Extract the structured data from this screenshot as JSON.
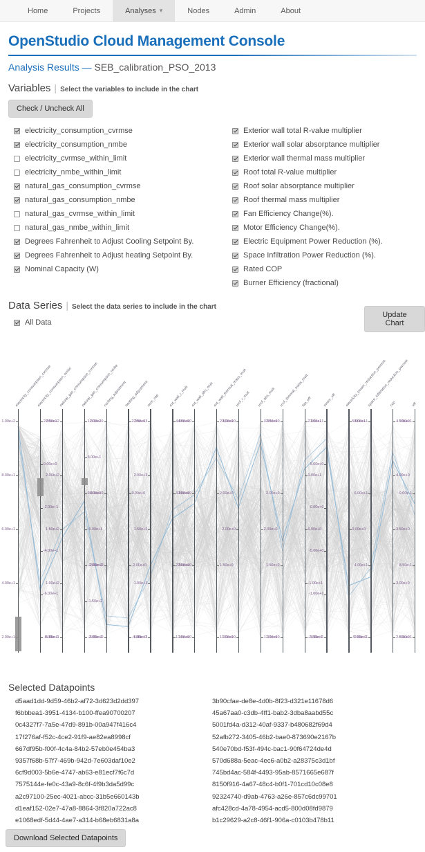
{
  "navbar": {
    "items": [
      {
        "label": "Home",
        "active": false,
        "caret": false
      },
      {
        "label": "Projects",
        "active": false,
        "caret": false
      },
      {
        "label": "Analyses",
        "active": true,
        "caret": true
      },
      {
        "label": "Nodes",
        "active": false,
        "caret": false
      },
      {
        "label": "Admin",
        "active": false,
        "caret": false
      },
      {
        "label": "About",
        "active": false,
        "caret": false
      }
    ],
    "caret_glyph": "▾"
  },
  "header": {
    "app_title": "OpenStudio Cloud Management Console",
    "page_label": "Analysis Results",
    "dash": "—",
    "analysis_name": "SEB_calibration_PSO_2013",
    "accent_color": "#1a6fbb"
  },
  "variables": {
    "heading": "Variables",
    "separator": "|",
    "hint": "Select the variables to include in the chart",
    "check_all_label": "Check / Uncheck All",
    "left_column": [
      {
        "label": "electricity_consumption_cvrmse",
        "checked": true
      },
      {
        "label": "electricity_consumption_nmbe",
        "checked": true
      },
      {
        "label": "electricity_cvrmse_within_limit",
        "checked": false
      },
      {
        "label": "electricity_nmbe_within_limit",
        "checked": false
      },
      {
        "label": "natural_gas_consumption_cvrmse",
        "checked": true
      },
      {
        "label": "natural_gas_consumption_nmbe",
        "checked": true
      },
      {
        "label": "natural_gas_cvrmse_within_limit",
        "checked": false
      },
      {
        "label": "natural_gas_nmbe_within_limit",
        "checked": false
      },
      {
        "label": "Degrees Fahrenheit to Adjust Cooling Setpoint By.",
        "checked": true
      },
      {
        "label": "Degrees Fahrenheit to Adjust heating Setpoint By.",
        "checked": true
      },
      {
        "label": "Nominal Capacity (W)",
        "checked": true
      }
    ],
    "right_column": [
      {
        "label": "Exterior wall total R-value multiplier",
        "checked": true
      },
      {
        "label": "Exterior wall solar absorptance multiplier",
        "checked": true
      },
      {
        "label": "Exterior wall thermal mass multiplier",
        "checked": true
      },
      {
        "label": "Roof total R-value multiplier",
        "checked": true
      },
      {
        "label": "Roof solar absorptance multiplier",
        "checked": true
      },
      {
        "label": "Roof thermal mass multiplier",
        "checked": true
      },
      {
        "label": "Fan Efficiency Change(%).",
        "checked": true
      },
      {
        "label": "Motor Efficiency Change(%).",
        "checked": true
      },
      {
        "label": "Electric Equipment Power Reduction (%).",
        "checked": true
      },
      {
        "label": "Space Infiltration Power Reduction (%).",
        "checked": true
      },
      {
        "label": "Rated COP",
        "checked": true
      },
      {
        "label": "Burner Efficiency (fractional)",
        "checked": true
      }
    ]
  },
  "data_series": {
    "heading": "Data Series",
    "separator": "|",
    "hint": "Select the data series to include in the chart",
    "items": [
      {
        "label": "All Data",
        "checked": true
      }
    ]
  },
  "toolbar": {
    "update_chart_label": "Update Chart",
    "download_label": "Download Selected Datapoints"
  },
  "chart_data": {
    "type": "line",
    "subtype": "parallel-coordinates",
    "title": "",
    "xlabel": "",
    "ylabel": "",
    "grid": false,
    "legend": "none",
    "highlight_color": "#8fb8d6",
    "line_color": "#d9d9d9",
    "axes": [
      {
        "name": "electricity_consumption_cvrmse",
        "ticks": [
          "1.00e+2",
          "8.00e+1",
          "6.00e+1",
          "4.00e+1",
          "2.00e+1"
        ],
        "brush": true
      },
      {
        "name": "electricity_consumption_nmbe",
        "ticks": [
          "2.00e+1",
          "0.00e+0",
          "-2.00e+1",
          "-4.00e+1",
          "-6.00e+1",
          "-8.00e+1"
        ],
        "brush": true
      },
      {
        "name": "natural_gas_consumption_cvrmse",
        "ticks": [
          "2.50e+2",
          "2.00e+2",
          "1.50e+2",
          "1.00e+2",
          "5.00e+1"
        ],
        "brush": false
      },
      {
        "name": "natural_gas_consumption_nmbe",
        "ticks": [
          "1.00e+2",
          "5.00e+1",
          "0.00e+0",
          "-5.00e+1",
          "-1.00e+2",
          "-1.50e+2",
          "-2.00e+2"
        ],
        "brush": true
      },
      {
        "name": "cooling_adjustment",
        "ticks": [
          "2.00e+0",
          "0.00e+0",
          "-2.00e+0",
          "-4.00e+0"
        ],
        "brush": false
      },
      {
        "name": "heating_adjustment",
        "ticks": [
          "2.00e+0",
          "0.00e+0",
          "-2.00e+0",
          "-4.00e+0"
        ],
        "brush": false
      },
      {
        "name": "nom_cap",
        "ticks": [
          "2.50e+3",
          "2.00e+3",
          "1.50e+3",
          "1.00e+3",
          "5.00e+2"
        ],
        "brush": false
      },
      {
        "name": "ext_wall_r_mult",
        "ticks": [
          "4.00e+0",
          "3.00e+0",
          "2.00e+0",
          "1.00e+0"
        ],
        "brush": false
      },
      {
        "name": "ext_wall_abs_mult",
        "ticks": [
          "4.00e+0",
          "3.00e+0",
          "2.00e+0",
          "1.00e+0"
        ],
        "brush": false
      },
      {
        "name": "ext_wall_thermal_mass_mult",
        "ticks": [
          "2.50e+0",
          "2.00e+0",
          "1.50e+0",
          "1.00e+0"
        ],
        "brush": false
      },
      {
        "name": "roof_r_mult",
        "ticks": [
          "3.00e+0",
          "2.00e+0",
          "1.00e+0"
        ],
        "brush": false
      },
      {
        "name": "roof_abs_mult",
        "ticks": [
          "3.00e+0",
          "2.00e+0",
          "1.00e+0"
        ],
        "brush": false
      },
      {
        "name": "roof_thermal_mass_mult",
        "ticks": [
          "2.50e+0",
          "2.00e+0",
          "1.50e+0",
          "1.00e+0"
        ],
        "brush": false
      },
      {
        "name": "fan_eff",
        "ticks": [
          "2.00e+1",
          "1.00e+1",
          "0.00e+0",
          "-1.00e+1",
          "-2.00e+1"
        ],
        "brush": false
      },
      {
        "name": "motor_eff",
        "ticks": [
          "1.00e+1",
          "5.00e+0",
          "0.00e+0",
          "-5.00e+0",
          "-1.00e+1",
          "-1.50e+1"
        ],
        "brush": false
      },
      {
        "name": "electricity_power_reduction_percent",
        "ticks": [
          "5.00e+1",
          "0.00e+0",
          "-5.00e+1"
        ],
        "brush": false
      },
      {
        "name": "space_infiltration_reduction_percent",
        "ticks": [
          "8.00e+1",
          "6.00e+1",
          "4.00e+1",
          "2.00e+1"
        ],
        "brush": false
      },
      {
        "name": "cop",
        "ticks": [
          "4.50e+0",
          "4.00e+0",
          "3.50e+0",
          "3.00e+0",
          "2.50e+0"
        ],
        "brush": false
      },
      {
        "name": "eff",
        "ticks": [
          "9.50e-1",
          "9.00e-1",
          "8.50e-1",
          "8.00e-1"
        ],
        "brush": false
      }
    ],
    "highlighted_series": {
      "name": "selected-datapoint-path",
      "values_normalized": [
        0.98,
        0.22,
        0.46,
        0.63,
        0.06,
        0.05,
        0.33,
        0.55,
        0.62,
        0.88,
        0.6,
        0.9,
        0.45,
        0.78,
        0.88,
        0.24,
        0.28,
        0.82,
        0.62
      ]
    }
  },
  "selected_datapoints": {
    "title": "Selected Datapoints",
    "column_a": [
      "d5aad1dd-9d59-46b2-af72-3d623d2dd397",
      "f6bbbea1-3951-4134-b100-ffea90700207",
      "0c4327f7-7a5e-47d9-891b-00a947f416c4",
      "17f276af-f52c-4ce2-91f9-ae82ea8998cf",
      "667df95b-f00f-4c4a-84b2-57eb0e454ba3",
      "9357f68b-57f7-469b-942d-7e603daf10e2",
      "6cf9d003-5b6e-4747-ab63-e81ecf7f6c7d",
      "7575144e-fe0c-43a9-8c6f-4f9b3da5d99c",
      "a2c97100-25ec-4021-abcc-31b5e660143b",
      "d1eaf152-02e7-47a8-8864-3f820a722ac8",
      "e1068edf-5d44-4ae7-a314-b68eb6831a8a"
    ],
    "column_b": [
      "3b90cfae-de8e-4d0b-8f23-d321e11678d6",
      "45a67aa0-c3db-4ff1-bab2-3dba8aabd55c",
      "5001fd4a-d312-40af-9337-b480682f69d4",
      "52afb272-3405-46b2-bae0-873690e2167b",
      "540e70bd-f53f-494c-bac1-90f64724de4d",
      "570d688a-5eac-4ec6-a0b2-a28375c3d1bf",
      "745bd4ac-584f-4493-95ab-8571665e687f",
      "8150f916-4a67-48c4-b0f1-701cd10c08e8",
      "92324740-d9ab-4763-a26e-857c6dc99701",
      "afc428cd-4a78-4954-acd5-800d08fd9879",
      "b1c29629-a2c8-46f1-906a-c0103b478b11"
    ]
  }
}
